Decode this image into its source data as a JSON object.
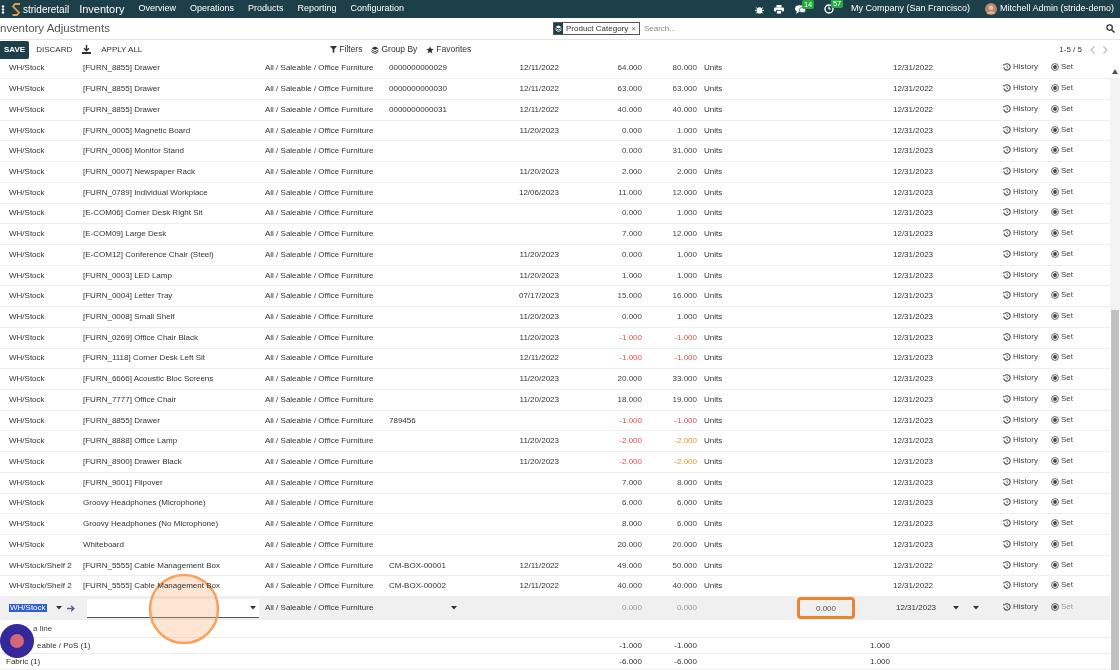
{
  "navbar": {
    "brand": "strideretail",
    "app": "Inventory",
    "menu": [
      "Overview",
      "Operations",
      "Products",
      "Reporting",
      "Configuration"
    ],
    "chat_count": "14",
    "activity_count": "57",
    "company": "My Company (San Francisco)",
    "user": "Mitchell Admin (stride-demo)"
  },
  "title": "nventory Adjustments",
  "search": {
    "facet": "Product Category",
    "facet_close": "×",
    "placeholder": "Search..."
  },
  "actions": [
    "SAVE",
    "DISCARD",
    "APPLY ALL"
  ],
  "filters": [
    "Filters",
    "Group By",
    "Favorites"
  ],
  "pager": "1-5 / 5",
  "rows": [
    {
      "location": "WH/Stock",
      "product": "[FURN_8855] Drawer",
      "category": "All / Saleable / Office Furniture",
      "lot": "0000000000029",
      "in_date": "12/11/2022",
      "on_hand": "64.000",
      "available": "80.000",
      "negative": false,
      "pending": false,
      "uom": "Units",
      "scheduled": "12/31/2022",
      "history": "History",
      "set": "Set"
    },
    {
      "location": "WH/Stock",
      "product": "[FURN_8855] Drawer",
      "category": "All / Saleable / Office Furniture",
      "lot": "0000000000030",
      "in_date": "12/11/2022",
      "on_hand": "63.000",
      "available": "63.000",
      "negative": false,
      "pending": false,
      "uom": "Units",
      "scheduled": "12/31/2022",
      "history": "History",
      "set": "Set"
    },
    {
      "location": "WH/Stock",
      "product": "[FURN_8855] Drawer",
      "category": "All / Saleable / Office Furniture",
      "lot": "0000000000031",
      "in_date": "12/11/2022",
      "on_hand": "40.000",
      "available": "40.000",
      "negative": false,
      "pending": false,
      "uom": "Units",
      "scheduled": "12/31/2022",
      "history": "History",
      "set": "Set"
    },
    {
      "location": "WH/Stock",
      "product": "[FURN_0005] Magnetic Board",
      "category": "All / Saleable / Office Furniture",
      "in_date": "11/20/2023",
      "on_hand": "0.000",
      "available": "1.000",
      "negative": false,
      "pending": false,
      "uom": "Units",
      "scheduled": "12/31/2023",
      "history": "History",
      "set": "Set"
    },
    {
      "location": "WH/Stock",
      "product": "[FURN_0006] Monitor Stand",
      "category": "All / Saleable / Office Furniture",
      "on_hand": "0.000",
      "available": "31.000",
      "negative": false,
      "pending": false,
      "uom": "Units",
      "scheduled": "12/31/2023",
      "history": "History",
      "set": "Set"
    },
    {
      "location": "WH/Stock",
      "product": "[FURN_0007] Newspaper Rack",
      "category": "All / Saleable / Office Furniture",
      "in_date": "11/20/2023",
      "on_hand": "2.000",
      "available": "2.000",
      "negative": false,
      "pending": false,
      "uom": "Units",
      "scheduled": "12/31/2023",
      "history": "History",
      "set": "Set"
    },
    {
      "location": "WH/Stock",
      "product": "[FURN_0789] Individual Workplace",
      "category": "All / Saleable / Office Furniture",
      "in_date": "12/06/2023",
      "on_hand": "11.000",
      "available": "12.000",
      "negative": false,
      "pending": false,
      "uom": "Units",
      "scheduled": "12/31/2023",
      "history": "History",
      "set": "Set"
    },
    {
      "location": "WH/Stock",
      "product": "[E-COM06] Corner Desk Right Sit",
      "category": "All / Saleable / Office Furniture",
      "on_hand": "0.000",
      "available": "1.000",
      "negative": false,
      "pending": false,
      "uom": "Units",
      "scheduled": "12/31/2023",
      "history": "History",
      "set": "Set"
    },
    {
      "location": "WH/Stock",
      "product": "[E-COM09] Large Desk",
      "category": "All / Saleable / Office Furniture",
      "on_hand": "7.000",
      "available": "12.000",
      "negative": false,
      "pending": false,
      "uom": "Units",
      "scheduled": "12/31/2023",
      "history": "History",
      "set": "Set"
    },
    {
      "location": "WH/Stock",
      "product": "[E-COM12] Conference Chair (Steel)",
      "category": "All / Saleable / Office Furniture",
      "in_date": "11/20/2023",
      "on_hand": "0.000",
      "available": "1.000",
      "negative": false,
      "pending": false,
      "uom": "Units",
      "scheduled": "12/31/2023",
      "history": "History",
      "set": "Set"
    },
    {
      "location": "WH/Stock",
      "product": "[FURN_0003] LED Lamp",
      "category": "All / Saleable / Office Furniture",
      "in_date": "11/20/2023",
      "on_hand": "1.000",
      "available": "1.000",
      "negative": false,
      "pending": false,
      "uom": "Units",
      "scheduled": "12/31/2023",
      "history": "History",
      "set": "Set"
    },
    {
      "location": "WH/Stock",
      "product": "[FURN_0004] Letter Tray",
      "category": "All / Saleable / Office Furniture",
      "in_date": "07/17/2023",
      "on_hand": "15.000",
      "available": "16.000",
      "negative": false,
      "pending": false,
      "uom": "Units",
      "scheduled": "12/31/2023",
      "history": "History",
      "set": "Set"
    },
    {
      "location": "WH/Stock",
      "product": "[FURN_0008] Small Shelf",
      "category": "All / Saleable / Office Furniture",
      "in_date": "11/20/2023",
      "on_hand": "0.000",
      "available": "1.000",
      "negative": false,
      "pending": false,
      "uom": "Units",
      "scheduled": "12/31/2023",
      "history": "History",
      "set": "Set"
    },
    {
      "location": "WH/Stock",
      "product": "[FURN_0269] Office Chair Black",
      "category": "All / Saleable / Office Furniture",
      "in_date": "11/20/2023",
      "on_hand": "-1.000",
      "available": "-1.000",
      "negative": true,
      "pending": false,
      "uom": "Units",
      "scheduled": "12/31/2023",
      "history": "History",
      "set": "Set"
    },
    {
      "location": "WH/Stock",
      "product": "[FURN_1118] Corner Desk Left Sit",
      "category": "All / Saleable / Office Furniture",
      "in_date": "12/11/2022",
      "on_hand": "-1.000",
      "available": "-1.000",
      "negative": true,
      "pending": false,
      "uom": "Units",
      "scheduled": "12/31/2023",
      "history": "History",
      "set": "Set"
    },
    {
      "location": "WH/Stock",
      "product": "[FURN_6666] Acoustic Bloc Screens",
      "category": "All / Saleable / Office Furniture",
      "in_date": "11/20/2023",
      "on_hand": "20.000",
      "available": "33.000",
      "negative": false,
      "pending": false,
      "uom": "Units",
      "scheduled": "12/31/2023",
      "history": "History",
      "set": "Set"
    },
    {
      "location": "WH/Stock",
      "product": "[FURN_7777] Office Chair",
      "category": "All / Saleable / Office Furniture",
      "in_date": "11/20/2023",
      "on_hand": "18.000",
      "available": "19.000",
      "negative": false,
      "pending": false,
      "uom": "Units",
      "scheduled": "12/31/2023",
      "history": "History",
      "set": "Set"
    },
    {
      "location": "WH/Stock",
      "product": "[FURN_8855] Drawer",
      "category": "All / Saleable / Office Furniture",
      "lot": "789456",
      "on_hand": "-1.000",
      "available": "-1.000",
      "negative": true,
      "pending": false,
      "uom": "Units",
      "scheduled": "12/31/2023",
      "history": "History",
      "set": "Set"
    },
    {
      "location": "WH/Stock",
      "product": "[FURN_8888] Office Lamp",
      "category": "All / Saleable / Office Furniture",
      "in_date": "11/20/2023",
      "on_hand": "-2.000",
      "available": "-2.000",
      "negative": true,
      "pending": true,
      "uom": "Units",
      "scheduled": "12/31/2023",
      "history": "History",
      "set": "Set"
    },
    {
      "location": "WH/Stock",
      "product": "[FURN_8900] Drawer Black",
      "category": "All / Saleable / Office Furniture",
      "in_date": "11/20/2023",
      "on_hand": "-2.000",
      "available": "-2.000",
      "negative": true,
      "pending": true,
      "uom": "Units",
      "scheduled": "12/31/2023",
      "history": "History",
      "set": "Set"
    },
    {
      "location": "WH/Stock",
      "product": "[FURN_9001] Flipover",
      "category": "All / Saleable / Office Furniture",
      "on_hand": "7.000",
      "available": "8.000",
      "negative": false,
      "pending": false,
      "uom": "Units",
      "scheduled": "12/31/2023",
      "history": "History",
      "set": "Set"
    },
    {
      "location": "WH/Stock",
      "product": "Groovy Headphones (Microphone)",
      "category": "All / Saleable / Office Furniture",
      "on_hand": "6.000",
      "available": "6.000",
      "negative": false,
      "pending": false,
      "uom": "Units",
      "scheduled": "12/31/2023",
      "history": "History",
      "set": "Set"
    },
    {
      "location": "WH/Stock",
      "product": "Groovy Headphones (No Microphone)",
      "category": "All / Saleable / Office Furniture",
      "on_hand": "8.000",
      "available": "6.000",
      "negative": false,
      "pending": false,
      "uom": "Units",
      "scheduled": "12/31/2023",
      "history": "History",
      "set": "Set"
    },
    {
      "location": "WH/Stock",
      "product": "Whiteboard",
      "category": "All / Saleable / Office Furniture",
      "on_hand": "20.000",
      "available": "20.000",
      "negative": false,
      "pending": false,
      "uom": "Units",
      "scheduled": "12/31/2023",
      "history": "History",
      "set": "Set"
    },
    {
      "location": "WH/Stock/Shelf 2",
      "product": "[FURN_5555] Cable Management Box",
      "category": "All / Saleable / Office Furniture",
      "lot": "CM-BOX-00001",
      "in_date": "12/11/2022",
      "on_hand": "49.000",
      "available": "50.000",
      "negative": false,
      "pending": false,
      "uom": "Units",
      "scheduled": "12/31/2022",
      "history": "History",
      "set": "Set"
    },
    {
      "location": "WH/Stock/Shelf 2",
      "product": "[FURN_5555] Cable Management Box",
      "category": "All / Saleable / Office Furniture",
      "lot": "CM-BOX-00002",
      "in_date": "12/11/2022",
      "on_hand": "40.000",
      "available": "40.000",
      "negative": false,
      "pending": false,
      "uom": "Units",
      "scheduled": "12/31/2022",
      "history": "History",
      "set": "Set"
    }
  ],
  "edit_row": {
    "location": "WH/Stock",
    "category": "All / Saleable / Office Furniture",
    "on_hand": "0.000",
    "available": "0.000",
    "counted": "0.000",
    "scheduled": "12/31/2023",
    "history": "History",
    "set": "Set"
  },
  "add_line": "a line",
  "groups": [
    {
      "label": "eable / PoS (1)",
      "on_hand": "-1.000",
      "available": "-1.000",
      "difference": "1.000"
    },
    {
      "label": "Fabric (1)",
      "on_hand": "-6.000",
      "available": "-6.000",
      "difference": "1.000"
    }
  ]
}
